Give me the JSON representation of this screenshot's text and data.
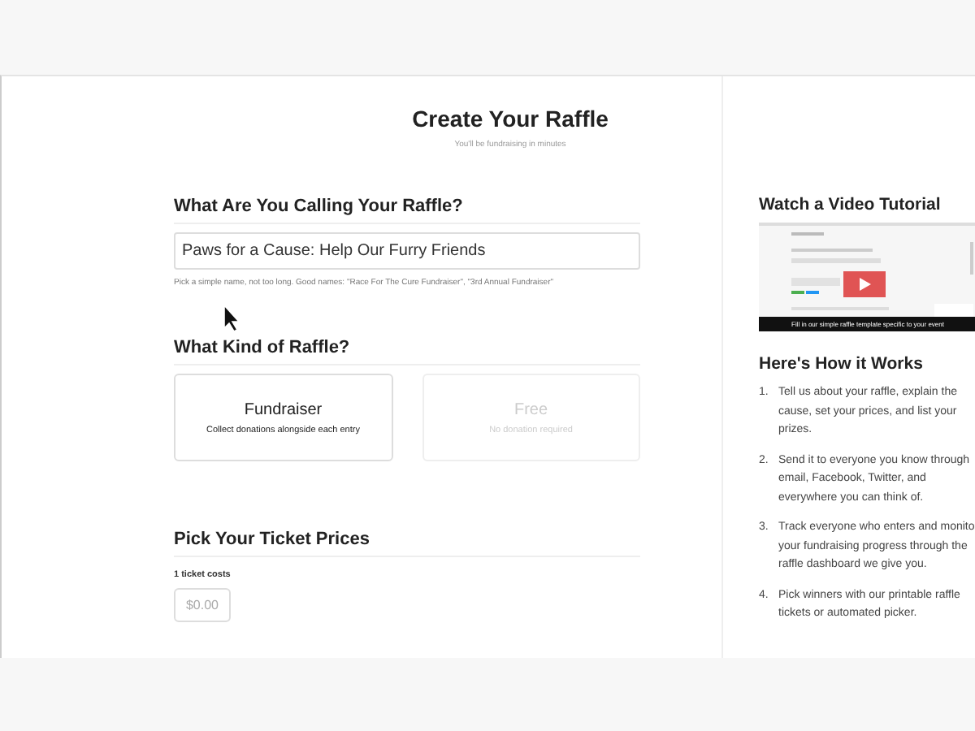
{
  "header": {
    "title": "Create Your Raffle",
    "subtitle": "You'll be fundraising in minutes"
  },
  "name_section": {
    "heading": "What Are You Calling Your Raffle?",
    "value": "Paws for a Cause: Help Our Furry Friends",
    "hint": "Pick a simple name, not too long. Good names: \"Race For The Cure Fundraiser\", \"3rd Annual Fundraiser\""
  },
  "kind_section": {
    "heading": "What Kind of Raffle?",
    "options": [
      {
        "title": "Fundraiser",
        "description": "Collect donations alongside each entry",
        "selected": true
      },
      {
        "title": "Free",
        "description": "No donation required",
        "selected": false
      }
    ]
  },
  "price_section": {
    "heading": "Pick Your Ticket Prices",
    "label": "1 ticket costs",
    "placeholder": "$0.00"
  },
  "sidebar": {
    "video_heading": "Watch a Video Tutorial",
    "video_caption": "Fill in our simple raffle template specific to your event",
    "steps_heading": "Here's How it Works",
    "steps": [
      {
        "number": "1.",
        "text": "Tell us about your raffle, explain the cause, set your prices, and list your prizes."
      },
      {
        "number": "2.",
        "text": "Send it to everyone you know through email, Facebook, Twitter, and everywhere you can think of."
      },
      {
        "number": "3.",
        "text": "Track everyone who enters and monito your fundraising progress through the raffle dashboard we give you."
      },
      {
        "number": "4.",
        "text": "Pick winners with our printable raffle tickets or automated picker."
      }
    ]
  }
}
